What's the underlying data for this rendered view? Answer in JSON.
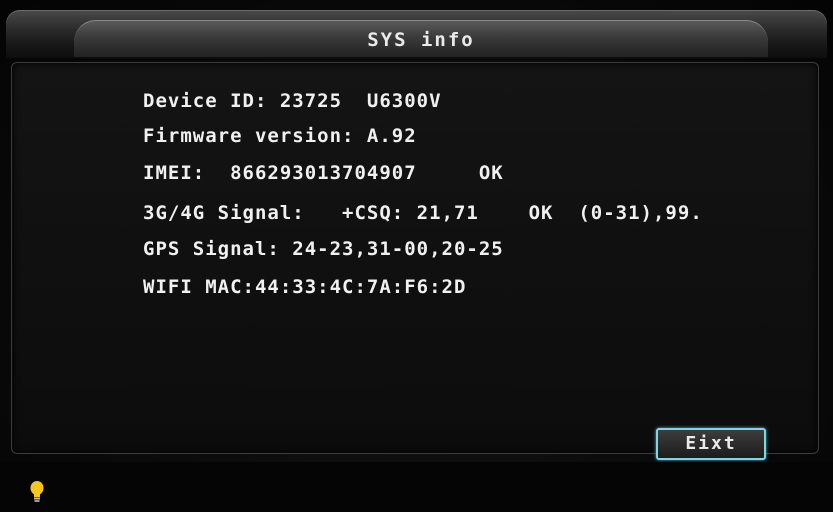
{
  "window": {
    "title": "SYS info"
  },
  "info": {
    "lines": [
      "Device ID: 23725  U6300V",
      "Firmware version: A.92",
      "IMEI:  866293013704907     OK",
      "3G/4G Signal:   +CSQ: 21,71    OK  (0-31),99.",
      "GPS Signal: 24-23,31-00,20-25",
      "WIFI MAC:44:33:4C:7A:F6:2D"
    ]
  },
  "buttons": {
    "exit_label": "Eixt"
  },
  "colors": {
    "text": "#f0f0f0",
    "button_border": "#7fd6e6",
    "bulb": "#f7c51e"
  },
  "icons": {
    "status": "lightbulb-icon"
  }
}
